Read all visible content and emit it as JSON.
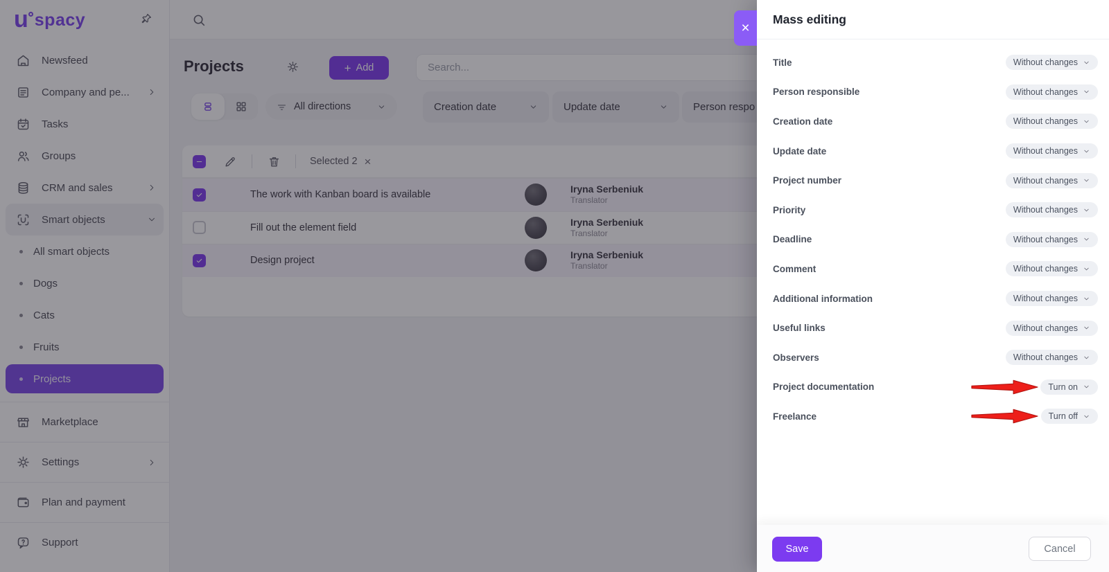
{
  "brand": {
    "logo_u": "u",
    "logo_rest": "spacy"
  },
  "colors": {
    "accent": "#7c3aed",
    "accent_bright": "#8b5cf6",
    "selected_item": "#7b49e8",
    "arrow_red": "#ed1f1a"
  },
  "sidebar": {
    "items": [
      {
        "label": "Newsfeed",
        "icon": "home-icon"
      },
      {
        "label": "Company and pe...",
        "icon": "company-icon",
        "chevron": "right"
      },
      {
        "label": "Tasks",
        "icon": "tasks-icon"
      },
      {
        "label": "Groups",
        "icon": "groups-icon"
      },
      {
        "label": "CRM and sales",
        "icon": "crm-icon",
        "chevron": "right"
      },
      {
        "label": "Smart objects",
        "icon": "smart-objects-icon",
        "chevron": "down",
        "expanded": true
      }
    ],
    "smart_children": [
      {
        "label": "All smart objects",
        "selected": false
      },
      {
        "label": "Dogs",
        "selected": false
      },
      {
        "label": "Cats",
        "selected": false
      },
      {
        "label": "Fruits",
        "selected": false
      },
      {
        "label": "Projects",
        "selected": true
      }
    ],
    "footer_items": [
      {
        "label": "Marketplace",
        "icon": "marketplace-icon"
      },
      {
        "label": "Settings",
        "icon": "gear-icon",
        "chevron": "right"
      },
      {
        "label": "Plan and payment",
        "icon": "wallet-icon"
      },
      {
        "label": "Support",
        "icon": "support-icon"
      }
    ]
  },
  "content": {
    "title": "Projects",
    "add_button": "Add",
    "add_plus": "+",
    "search_placeholder": "Search...",
    "filters": {
      "directions": "All directions",
      "chips": [
        "Creation date",
        "Update date",
        "Person respo"
      ]
    },
    "toolbar": {
      "selected_text": "Selected 2",
      "clear_icon": "×"
    },
    "rows": [
      {
        "title": "The work with Kanban board is available",
        "checked": true,
        "person": "Iryna Serbeniuk",
        "role": "Translator"
      },
      {
        "title": "Fill out the element field",
        "checked": false,
        "person": "Iryna Serbeniuk",
        "role": "Translator"
      },
      {
        "title": "Design project",
        "checked": true,
        "person": "Iryna Serbeniuk",
        "role": "Translator"
      }
    ]
  },
  "panel": {
    "title": "Mass editing",
    "close_icon": "×",
    "fields": [
      {
        "label": "Title",
        "value": "Without changes"
      },
      {
        "label": "Person responsible",
        "value": "Without changes"
      },
      {
        "label": "Creation date",
        "value": "Without changes"
      },
      {
        "label": "Update date",
        "value": "Without changes"
      },
      {
        "label": "Project number",
        "value": "Without changes"
      },
      {
        "label": "Priority",
        "value": "Without changes"
      },
      {
        "label": "Deadline",
        "value": "Without changes"
      },
      {
        "label": "Comment",
        "value": "Without changes"
      },
      {
        "label": "Additional information",
        "value": "Without changes"
      },
      {
        "label": "Useful links",
        "value": "Without changes"
      },
      {
        "label": "Observers",
        "value": "Without changes"
      },
      {
        "label": "Project documentation",
        "value": "Turn on",
        "annotated": true
      },
      {
        "label": "Freelance",
        "value": "Turn off",
        "annotated": true
      }
    ],
    "save_label": "Save",
    "cancel_label": "Cancel"
  }
}
